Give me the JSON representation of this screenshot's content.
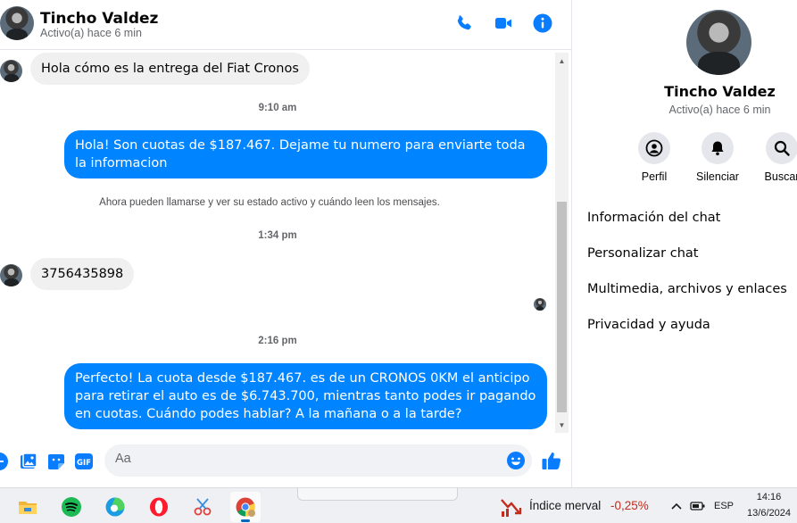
{
  "contact": {
    "name": "Tincho Valdez",
    "status": "Activo(a) hace 6 min"
  },
  "header_icons": [
    "phone-icon",
    "video-camera-icon",
    "info-icon"
  ],
  "messages": {
    "m1": "Hola cómo es la entrega del Fiat Cronos",
    "t1": "9:10 am",
    "m2": "Hola! Son cuotas de $187.467. Dejame tu numero para enviarte toda la informacion",
    "sys": "Ahora pueden llamarse y ver su estado activo y cuándo leen los mensajes.",
    "t2": "1:34 pm",
    "m3": "3756435898",
    "t3": "2:16 pm",
    "m4": "Perfecto! La cuota desde $187.467. es de un CRONOS 0KM el anticipo para retirar el auto es de $6.743.700, mientras tanto podes ir pagando en cuotas. Cuándo podes hablar? A la mañana o a la tarde?"
  },
  "composer": {
    "placeholder": "Aa",
    "icons": [
      "plus-circle-icon",
      "image-icon",
      "sticker-icon",
      "gif-icon",
      "emoji-icon",
      "like-icon"
    ],
    "gif_label": "GIF"
  },
  "panel": {
    "name": "Tincho Valdez",
    "status": "Activo(a) hace 6 min",
    "actions": [
      "Perfil",
      "Silenciar",
      "Buscar"
    ],
    "menu": [
      "Información del chat",
      "Personalizar chat",
      "Multimedia, archivos y enlaces",
      "Privacidad y ayuda"
    ]
  },
  "taskbar": {
    "apps": [
      "file-explorer-icon",
      "spotify-icon",
      "edge-icon",
      "opera-icon",
      "snipping-tool-icon",
      "chrome-icon"
    ],
    "widget_label": "Índice merval",
    "widget_value": "-0,25%",
    "language": "ESP",
    "time": "14:16",
    "date": "13/6/2024"
  },
  "colors": {
    "accent": "#0084ff",
    "icon_blue": "#0a7cff",
    "negative": "#c42b1c"
  }
}
